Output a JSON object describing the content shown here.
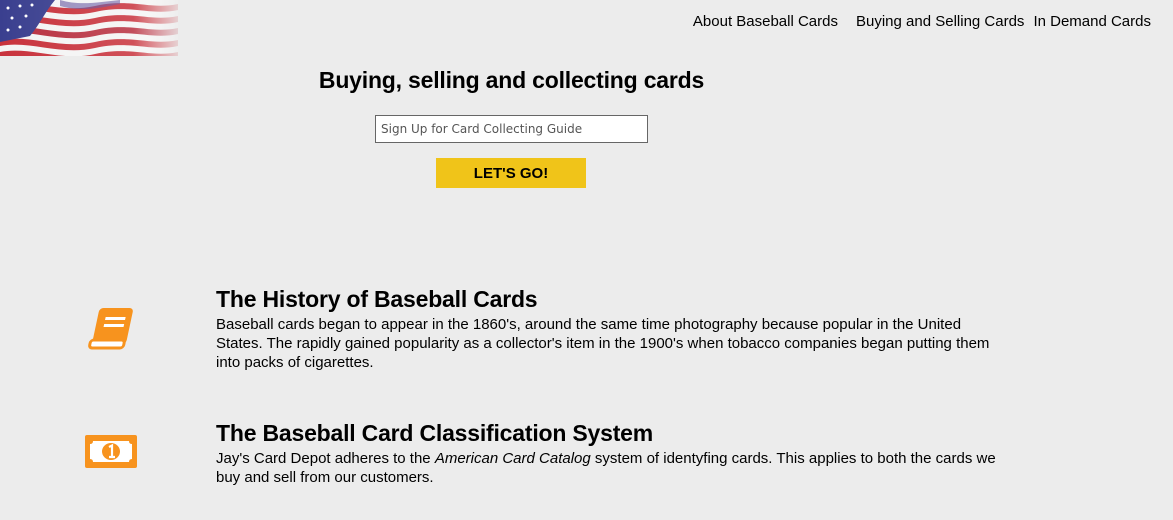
{
  "logo": {
    "icon": "american-flag-icon"
  },
  "nav": {
    "items": [
      {
        "label": "About Baseball Cards"
      },
      {
        "label": "Buying and Selling Cards"
      },
      {
        "label": "In Demand Cards"
      }
    ]
  },
  "hero": {
    "title": "Buying, selling and collecting cards",
    "signup_placeholder": "Sign Up for Card Collecting Guide",
    "button_label": "LET'S GO!"
  },
  "features": [
    {
      "icon": "book-icon",
      "title": "The History of Baseball Cards",
      "text": "Baseball cards began to appear in the 1860's, around the same time photography because popular in the United States. The rapidly gained popularity as a collector's item in the 1900's when tobacco companies began putting them into packs of cigarettes."
    },
    {
      "icon": "money-bill-icon",
      "title": "The Baseball Card Classification System",
      "text_before": "Jay's Card Depot adheres to the ",
      "text_em": "American Card Catalog",
      "text_after": " system of identyfing cards. This applies to both the cards we buy and sell from our customers."
    }
  ],
  "colors": {
    "background": "#ececec",
    "accent_button": "#f0c419",
    "icon_orange": "#f7931e"
  }
}
